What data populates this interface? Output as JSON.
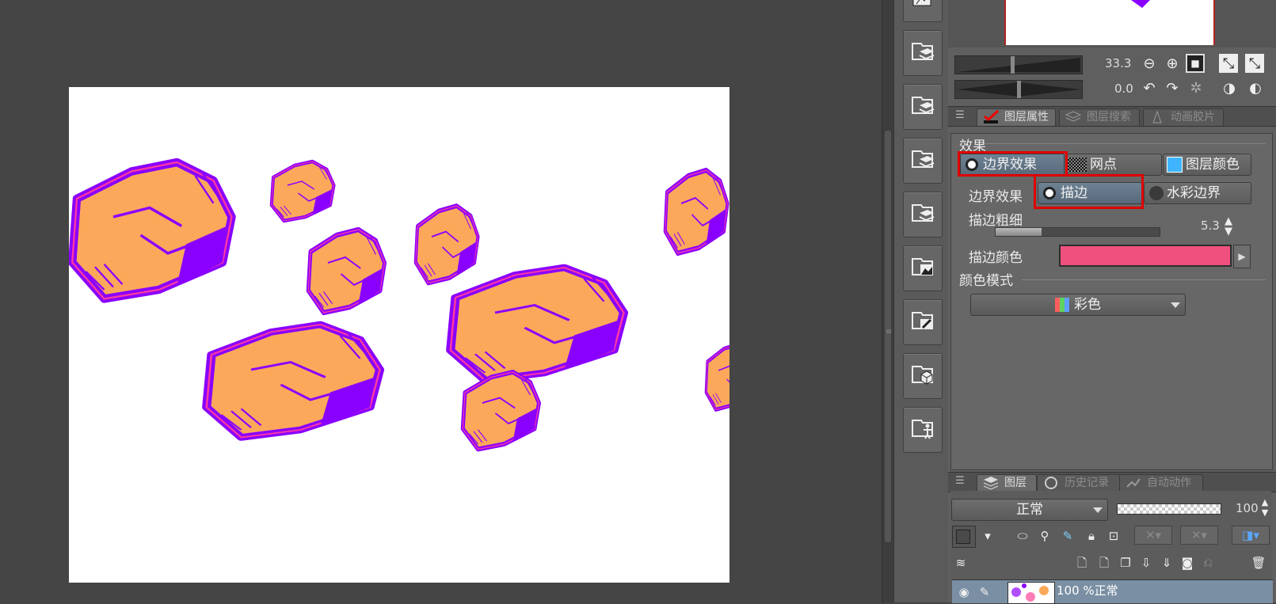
{
  "navigator": {
    "zoom_value": "33.3",
    "rotate_value": "0.0"
  },
  "property_tabs": [
    {
      "label": "图层属性",
      "active": true
    },
    {
      "label": "图层搜索",
      "active": false
    },
    {
      "label": "动画胶片",
      "active": false
    }
  ],
  "effects": {
    "section_label": "效果",
    "buttons": [
      {
        "label": "边界效果",
        "active": true
      },
      {
        "label": "网点",
        "active": false
      },
      {
        "label": "图层颜色",
        "active": false
      }
    ],
    "border_effect_label": "边界效果",
    "border_options": [
      {
        "label": "描边",
        "active": true
      },
      {
        "label": "水彩边界",
        "active": false
      }
    ],
    "stroke_width_label": "描边粗细",
    "stroke_width_value": "5.3",
    "stroke_color_label": "描边颜色",
    "stroke_color": "#f0507d",
    "color_mode_label": "颜色模式",
    "color_mode_value": "彩色"
  },
  "layer_tabs": [
    {
      "label": "图层",
      "active": true
    },
    {
      "label": "历史记录",
      "active": false
    },
    {
      "label": "自动动作",
      "active": false
    }
  ],
  "layer_panel": {
    "blend_mode": "正常",
    "opacity": "100",
    "layer_row_text": "100 %正常"
  },
  "colors": {
    "rock_fill": "#fca85a",
    "rock_outline": "#8a00ff",
    "rock_border": "#ff3aa0",
    "highlight_box": "#e00000"
  }
}
